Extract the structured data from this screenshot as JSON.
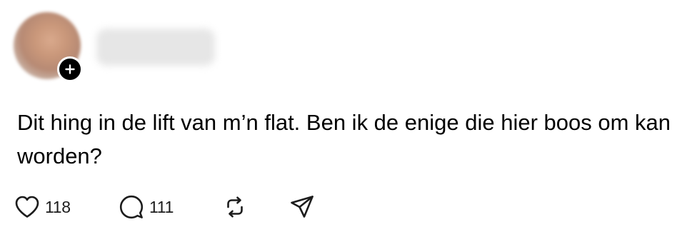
{
  "post": {
    "avatar": {
      "blurred": true,
      "alt": "profile-photo"
    },
    "follow_badge_icon": "plus-icon",
    "username": "username",
    "text": "Dit hing in de lift van m’n flat. Ben ik de enige die hier boos om kan worden?",
    "actions": {
      "like": {
        "icon": "heart-icon",
        "count": "118"
      },
      "reply": {
        "icon": "speech-bubble-icon",
        "count": "111"
      },
      "repost": {
        "icon": "repost-icon"
      },
      "share": {
        "icon": "paper-plane-icon"
      }
    }
  },
  "colors": {
    "background": "#ffffff",
    "text": "#000000",
    "icon": "#1c1c1c",
    "badge": "#000000"
  }
}
